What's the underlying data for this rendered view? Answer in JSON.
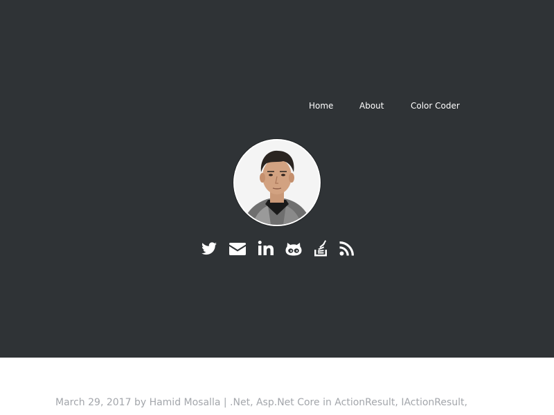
{
  "nav": {
    "items": [
      {
        "label": "Home"
      },
      {
        "label": "About"
      },
      {
        "label": "Color Coder"
      }
    ]
  },
  "profile": {
    "avatar": "profile-photo"
  },
  "social": {
    "icons": [
      "twitter-icon",
      "email-icon",
      "linkedin-icon",
      "github-icon",
      "stackoverflow-icon",
      "rss-icon"
    ]
  },
  "post": {
    "date": "March 29, 2017",
    "by": "by",
    "author": "Hamid Mosalla",
    "separator": "|",
    "category1": ".Net,",
    "category2": "Asp.Net Core",
    "in_word": "in",
    "tag1": "ActionResult,",
    "tag2": "IActionResult,"
  },
  "colors": {
    "header_bg": "#2f3336",
    "page_bg": "#ffffff",
    "meta_text": "#a3a6ab",
    "nav_text": "#ffffff"
  }
}
